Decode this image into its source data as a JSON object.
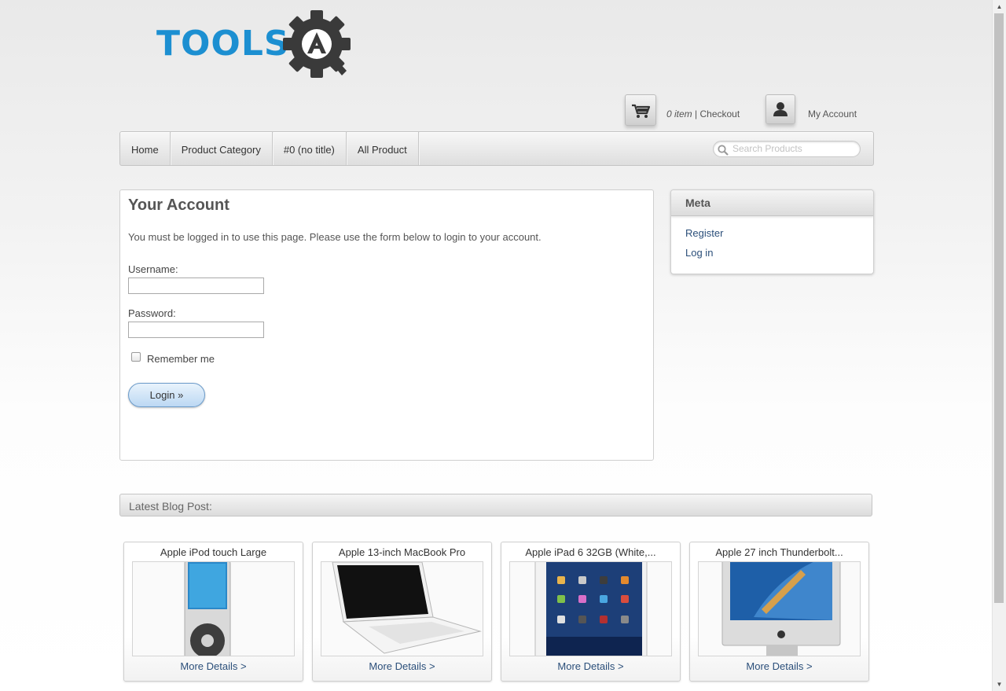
{
  "logo": {
    "text": "TOOLS"
  },
  "header": {
    "cart_count": "0 item",
    "separator": " | ",
    "checkout_label": "Checkout",
    "account_label": "My Account"
  },
  "nav": {
    "items": [
      {
        "label": "Home"
      },
      {
        "label": "Product Category"
      },
      {
        "label": "#0 (no title)"
      },
      {
        "label": "All Product"
      }
    ],
    "search_placeholder": "Search Products"
  },
  "account": {
    "title": "Your Account",
    "message": "You must be logged in to use this page. Please use the form below to login to your account.",
    "username_label": "Username:",
    "username_value": "",
    "password_label": "Password:",
    "password_value": "",
    "remember_label": "Remember me",
    "remember_checked": false,
    "login_label": "Login »"
  },
  "meta": {
    "title": "Meta",
    "links": [
      {
        "label": "Register"
      },
      {
        "label": "Log in"
      }
    ]
  },
  "blog": {
    "header": "Latest Blog Post:",
    "posts": [
      {
        "title": "Apple iPod touch Large",
        "more": "More Details >"
      },
      {
        "title": "Apple 13-inch MacBook Pro",
        "more": "More Details >"
      },
      {
        "title": "Apple iPad 6 32GB (White,...",
        "more": "More Details >"
      },
      {
        "title": "Apple 27 inch Thunderbolt...",
        "more": "More Details >"
      }
    ]
  },
  "colors": {
    "brand_blue": "#1c8fd1",
    "gear_dark": "#3a3a3a",
    "link": "#2b4f7a"
  },
  "icons": [
    "cart-icon",
    "user-icon",
    "search-icon",
    "gear-logo-icon"
  ]
}
